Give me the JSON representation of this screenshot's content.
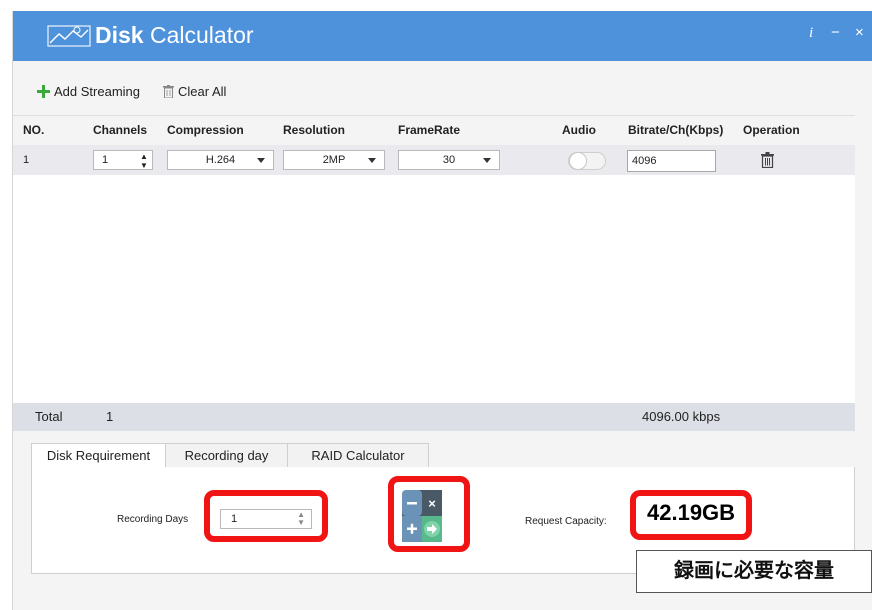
{
  "titlebar": {
    "title_bold": "Disk",
    "title_rest": " Calculator",
    "info_icon": "i",
    "minimize_icon": "−",
    "close_icon": "×"
  },
  "toolbar": {
    "add_label": "Add Streaming",
    "clear_label": "Clear All"
  },
  "table": {
    "headers": {
      "no": "NO.",
      "channels": "Channels",
      "compression": "Compression",
      "resolution": "Resolution",
      "framerate": "FrameRate",
      "audio": "Audio",
      "bitrate": "Bitrate/Ch(Kbps)",
      "operation": "Operation"
    },
    "rows": [
      {
        "no": "1",
        "channels": "1",
        "compression": "H.264",
        "resolution": "2MP",
        "framerate": "30",
        "audio_on": false,
        "bitrate": "4096"
      }
    ]
  },
  "total": {
    "label": "Total",
    "channels": "1",
    "bitrate": "4096.00 kbps"
  },
  "tabs": [
    {
      "label": "Disk Requirement",
      "active": true
    },
    {
      "label": "Recording day",
      "active": false
    },
    {
      "label": "RAID Calculator",
      "active": false
    }
  ],
  "disk_requirement": {
    "recording_days_label": "Recording Days",
    "recording_days_value": "1",
    "request_capacity_label": "Request Capacity:",
    "request_capacity_value": "42.19GB"
  },
  "annotation": {
    "text": "録画に必要な容量"
  },
  "colors": {
    "titlebar": "#4f92dc",
    "highlight": "#f01414",
    "add_icon": "#3aa83a"
  }
}
